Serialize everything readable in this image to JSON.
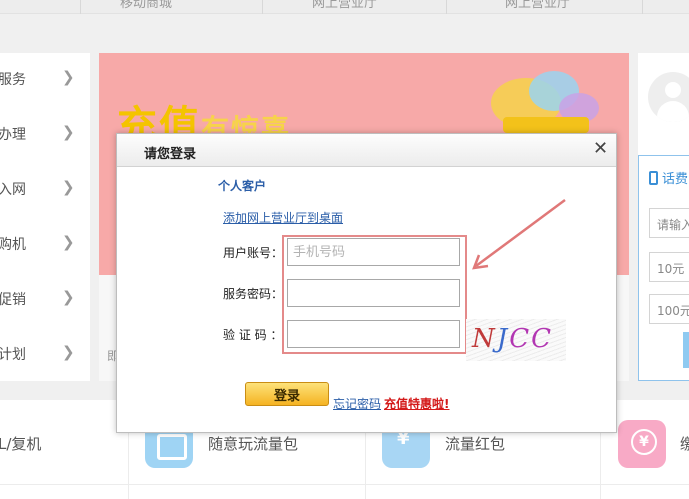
{
  "top_nav": {
    "fragments": [
      "移动商城",
      "网上营业厅",
      "网上营业厅"
    ]
  },
  "left_menu": {
    "items": [
      {
        "label": "服务"
      },
      {
        "label": "办理"
      },
      {
        "label": "入网"
      },
      {
        "label": "购机"
      },
      {
        "label": "促销"
      },
      {
        "label": "计划"
      }
    ],
    "chevron_icon": "chevron-right-icon"
  },
  "banner": {
    "headline_main": "充值",
    "headline_sub": "有惊喜"
  },
  "below_banner": {
    "fragment": "即"
  },
  "right_panel": {
    "recharge_title": "话费",
    "phone_placeholder": "请输入",
    "amount_1": "10元",
    "amount_2": "100元"
  },
  "bottom_services": [
    {
      "label": "L/复机"
    },
    {
      "label": "随意玩流量包",
      "icon": "traffic-package-icon"
    },
    {
      "label": "流量红包",
      "icon": "red-envelope-icon"
    },
    {
      "label": "缴",
      "icon": "payment-icon"
    }
  ],
  "login_modal": {
    "title": "请您登录",
    "close_icon": "close-icon",
    "customer_type": "个人客户",
    "add_shortcut_link": "添加网上营业厅到桌面",
    "account_label": "用户账号：",
    "account_placeholder": "手机号码",
    "account_value": "",
    "password_label": "服务密码：",
    "password_value": "",
    "captcha_label": "验 证 码 ：",
    "captcha_value": "",
    "captcha_text": [
      "N",
      "J",
      "C",
      "C"
    ],
    "login_button": "登录",
    "forgot_password_link": "忘记密码",
    "promo_link": "充值特惠啦!"
  },
  "colors": {
    "highlight_border": "#e48a8a",
    "annotation_arrow": "#e07878",
    "banner_bg": "#f7a9a8",
    "link_blue": "#2b5ea8",
    "promo_red": "#d41a1a"
  }
}
